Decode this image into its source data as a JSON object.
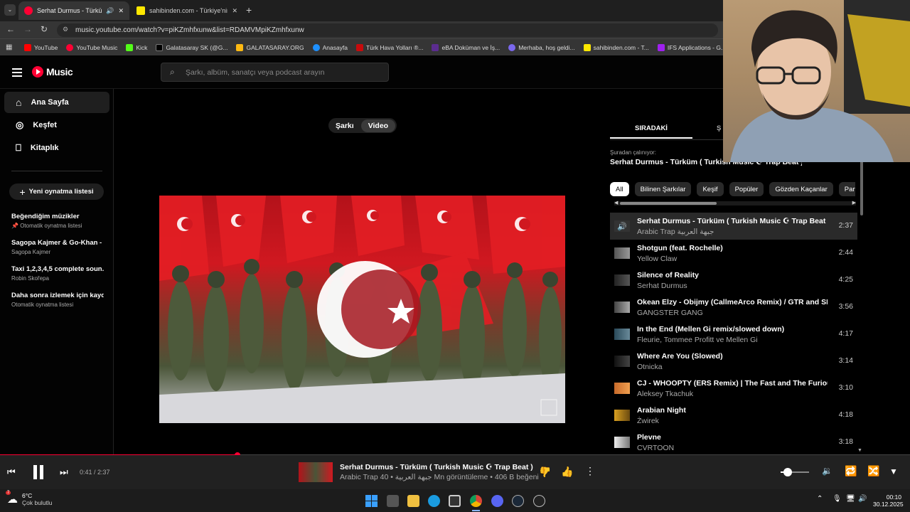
{
  "browser": {
    "tabs": [
      {
        "title": "Serhat Durmus - Türküm ( T",
        "active": true
      },
      {
        "title": "sahibinden.com - Türkiye'nin O",
        "active": false
      }
    ],
    "url": "music.youtube.com/watch?v=piKZmhfxunw&list=RDAMVMpiKZmhfxunw",
    "bookmarks": [
      "YouTube",
      "YouTube Music",
      "Kick",
      "Galatasaray SK (@G...",
      "GALATASARAY.ORG",
      "Anasayfa",
      "Türk Hava Yolları ®...",
      "eBA Doküman ve İş...",
      "Merhaba, hoş geldi...",
      "sahibinden.com - T...",
      "IFS Applications - G..."
    ]
  },
  "header": {
    "logo_text": "Music",
    "search_placeholder": "Şarkı, albüm, sanatçı veya podcast arayın"
  },
  "sidebar": {
    "nav": [
      "Ana Sayfa",
      "Keşfet",
      "Kitaplık"
    ],
    "new_playlist": "Yeni oynatma listesi",
    "playlists": [
      {
        "title": "Beğendiğim müzikler",
        "subtitle": "Otomatik oynatma listesi"
      },
      {
        "title": "Sagopa Kajmer & Go-Khan - ...",
        "subtitle": "Sagopa Kajmer"
      },
      {
        "title": "Taxi 1,2,3,4,5 complete soun...",
        "subtitle": "Robin Skořepa"
      },
      {
        "title": "Daha sonra izlemek için kayd...",
        "subtitle": "Otomatik oynatma listesi"
      }
    ]
  },
  "toggle": {
    "song": "Şarkı",
    "video": "Video"
  },
  "queue": {
    "tab_next": "SIRADAKİ",
    "tab_partial": "Ş",
    "playing_from_label": "Şuradan çalınıyor:",
    "playing_from_title": "Serhat Durmus - Türküm ( Turkish Music ☪ Trap Beat ) ...",
    "chips": [
      "All",
      "Bilinen Şarkılar",
      "Keşif",
      "Popüler",
      "Gözden Kaçanlar",
      "Parti"
    ],
    "items": [
      {
        "title": "Serhat Durmus - Türküm ( Turkish Music ☪︎ Trap Beat )",
        "artist": "Arabic Trap جبهة العربية",
        "duration": "2:37"
      },
      {
        "title": "Shotgun (feat. Rochelle)",
        "artist": "Yellow Claw",
        "duration": "2:44"
      },
      {
        "title": "Silence of Reality",
        "artist": "Serhat Durmus",
        "duration": "4:25"
      },
      {
        "title": "Okean Elzy - Obijmy (CallmeArco Remix) / GTR and SR...",
        "artist": "GANGSTER GANG",
        "duration": "3:56"
      },
      {
        "title": "In the End (Mellen Gi remix/slowed down)",
        "artist": "Fleurie, Tommee Profitt ve Mellen Gi",
        "duration": "4:17"
      },
      {
        "title": "Where Are You (Slowed)",
        "artist": "Otnicka",
        "duration": "3:14"
      },
      {
        "title": "CJ - WHOOPTY (ERS Remix) | The Fast and The Furious",
        "artist": "Aleksey Tkachuk",
        "duration": "3:10"
      },
      {
        "title": "Arabian Night",
        "artist": "Żwirek",
        "duration": "4:18"
      },
      {
        "title": "Plevne",
        "artist": "CVRTOON",
        "duration": "3:18"
      }
    ]
  },
  "player": {
    "time": "0:41 / 2:37",
    "progress": 0.261,
    "title": "Serhat Durmus - Türküm ( Turkish Music ☪︎ Trap Beat )",
    "meta": "Arabic Trap جبهة العربية • 40 Mn görüntüleme • 406 B beğeni",
    "volume": 0.25
  },
  "taskbar": {
    "weather_temp": "6°C",
    "weather_desc": "Çok bulutlu",
    "weather_badge": "7",
    "time": "00:10",
    "date": "30.12.2025"
  },
  "colors": {
    "accent": "#ff0033",
    "bg": "#030303",
    "player_bg": "#212121"
  }
}
